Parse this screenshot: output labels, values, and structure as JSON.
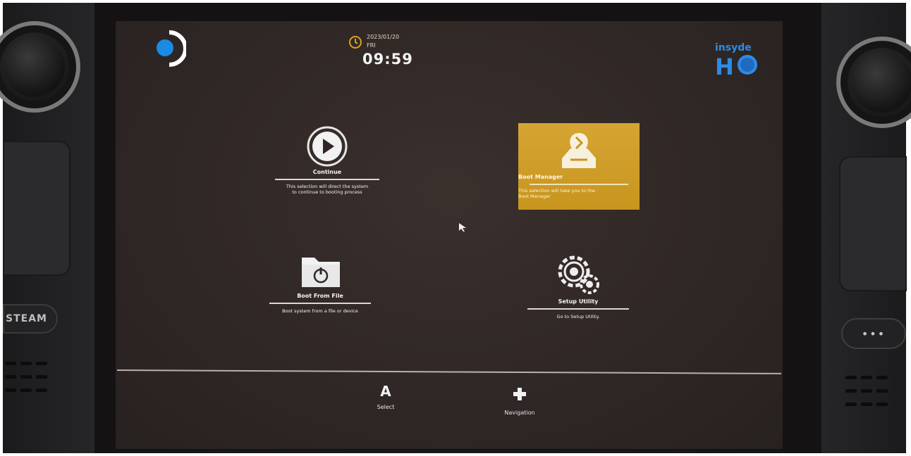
{
  "header": {
    "date": "2023/01/20",
    "day": "FRI",
    "time": "09:59",
    "vendor_logo": "insyde"
  },
  "menu": {
    "continue": {
      "label": "Continue",
      "description_line1": "This selection will direct the system",
      "description_line2": "to continue to booting process",
      "icon": "play-icon"
    },
    "boot_manager": {
      "label": "Boot Manager",
      "description_line1": "This selection will take you to the",
      "description_line2": "Boot Manager",
      "icon": "boot-manager-icon",
      "selected": true
    },
    "boot_from_file": {
      "label": "Boot From File",
      "description_line1": "Boot system from a file or device",
      "icon": "folder-power-icon"
    },
    "setup_utility": {
      "label": "Setup Utility",
      "description_line1": "Go to Setup Utility.",
      "icon": "gears-icon"
    }
  },
  "footer": {
    "select_key": "A",
    "select_label": "Select",
    "nav_label": "Navigation"
  },
  "device": {
    "steam_button": "STEAM",
    "menu_button": "•••"
  },
  "colors": {
    "selected_tile": "#c99a26",
    "background": "#2f2725",
    "accent_blue": "#2e8be6",
    "clock_icon": "#e0a020"
  }
}
